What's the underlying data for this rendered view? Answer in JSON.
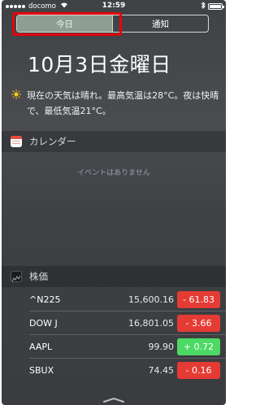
{
  "status_bar": {
    "carrier": "docomo",
    "time": "12:59",
    "battery_level": 1.0
  },
  "tabs": [
    {
      "label": "今日",
      "active": true
    },
    {
      "label": "通知",
      "active": false
    }
  ],
  "date_heading": "10月3日金曜日",
  "weather": {
    "icon": "sun-icon",
    "text": "現在の天気は晴れ。最高気温は28°C。夜は快晴で、最低気温21°C。"
  },
  "calendar": {
    "title": "カレンダー",
    "icon": "calendar-icon",
    "empty_text": "イベントはありません"
  },
  "stocks": {
    "title": "株価",
    "icon": "stocks-icon",
    "items": [
      {
        "symbol": "^N225",
        "price": "15,600.16",
        "change": "- 61.83",
        "color": "#e53b35"
      },
      {
        "symbol": "DOW J",
        "price": "16,801.05",
        "change": "- 3.66",
        "color": "#e53b35"
      },
      {
        "symbol": "AAPL",
        "price": "99.90",
        "change": "+ 0.72",
        "color": "#4cd964"
      },
      {
        "symbol": "SBUX",
        "price": "74.45",
        "change": "- 0.16",
        "color": "#e53b35"
      }
    ]
  },
  "colors": {
    "highlight": "#e8000b",
    "active_tab": "#8e9e92"
  }
}
